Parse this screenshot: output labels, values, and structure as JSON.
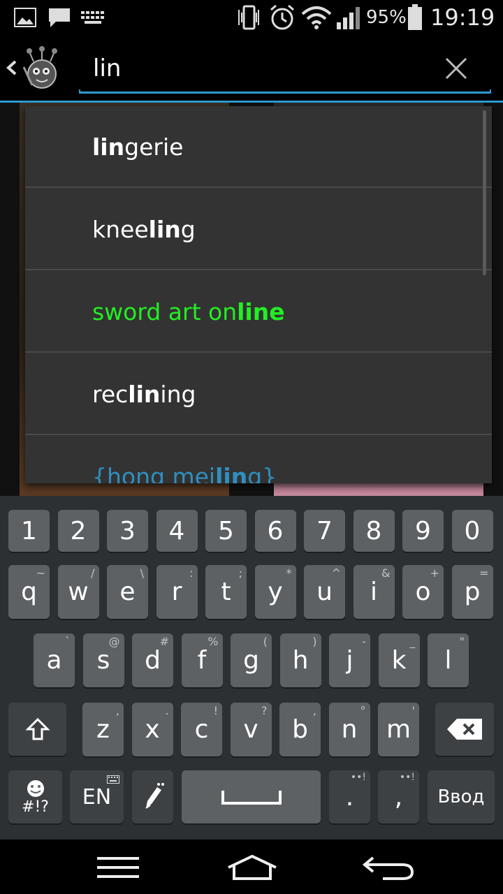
{
  "status_bar": {
    "battery_percent": "95%",
    "time": "19:19",
    "icons": [
      "gallery-icon",
      "message-icon",
      "keyboard-icon",
      "vibrate-icon",
      "alarm-icon",
      "wifi-icon",
      "signal-icon",
      "battery-icon"
    ]
  },
  "search": {
    "query": "lin",
    "accent_color": "#2f9ad0"
  },
  "suggestions": [
    {
      "pre": "",
      "match": "lin",
      "post": "gerie",
      "color": "#ffffff"
    },
    {
      "pre": "knee",
      "match": "lin",
      "post": "g",
      "color": "#ffffff"
    },
    {
      "pre": "sword art on",
      "match": "line",
      "post": "",
      "color": "#22ee22"
    },
    {
      "pre": "rec",
      "match": "lin",
      "post": "ing",
      "color": "#ffffff"
    },
    {
      "pre": "{hong mei",
      "match": "lin",
      "post": "g}",
      "color": "#2f8fc0"
    }
  ],
  "keyboard": {
    "row_numbers": [
      "1",
      "2",
      "3",
      "4",
      "5",
      "6",
      "7",
      "8",
      "9",
      "0"
    ],
    "row1": [
      {
        "k": "q",
        "s": "~"
      },
      {
        "k": "w",
        "s": "/"
      },
      {
        "k": "e",
        "s": "\\"
      },
      {
        "k": "r",
        "s": ":"
      },
      {
        "k": "t",
        "s": ";"
      },
      {
        "k": "y",
        "s": "*"
      },
      {
        "k": "u",
        "s": "^"
      },
      {
        "k": "i",
        "s": "&"
      },
      {
        "k": "o",
        "s": "+"
      },
      {
        "k": "p",
        "s": "="
      }
    ],
    "row2": [
      {
        "k": "a",
        "s": "`"
      },
      {
        "k": "s",
        "s": "@"
      },
      {
        "k": "d",
        "s": "#"
      },
      {
        "k": "f",
        "s": "%"
      },
      {
        "k": "g",
        "s": "("
      },
      {
        "k": "h",
        "s": ")"
      },
      {
        "k": "j",
        "s": "-"
      },
      {
        "k": "k",
        "s": "_"
      },
      {
        "k": "l",
        "s": "\""
      }
    ],
    "row3": [
      {
        "k": "z",
        "s": ","
      },
      {
        "k": "x",
        "s": "."
      },
      {
        "k": "c",
        "s": "!"
      },
      {
        "k": "v",
        "s": "?"
      },
      {
        "k": "b",
        "s": ","
      },
      {
        "k": "n",
        "s": "°"
      },
      {
        "k": "m",
        "s": "'"
      }
    ],
    "symbols_label": "#!?",
    "lang_label": "EN",
    "period_label": ".",
    "comma_label": ",",
    "enter_label": "Ввод"
  }
}
